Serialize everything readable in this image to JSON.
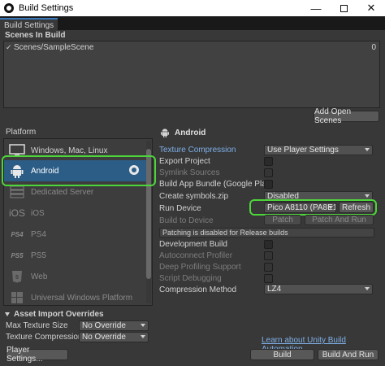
{
  "window": {
    "title": "Build Settings",
    "tab": "Build Settings"
  },
  "scenes": {
    "header": "Scenes In Build",
    "items": [
      {
        "name": "Scenes/SampleScene",
        "index": "0",
        "checked": true
      }
    ],
    "add_open_scenes": "Add Open Scenes"
  },
  "platform": {
    "header": "Platform",
    "items": [
      {
        "label": "Windows, Mac, Linux",
        "icon": "monitor-icon",
        "state": "normal"
      },
      {
        "label": "Android",
        "icon": "android-icon",
        "state": "selected"
      },
      {
        "label": "Dedicated Server",
        "icon": "server-icon",
        "state": "dim"
      },
      {
        "label": "iOS",
        "icon": "ios-icon",
        "state": "dim"
      },
      {
        "label": "PS4",
        "icon": "ps4-icon",
        "state": "dim"
      },
      {
        "label": "PS5",
        "icon": "ps5-icon",
        "state": "dim"
      },
      {
        "label": "Web",
        "icon": "html5-icon",
        "state": "dim"
      },
      {
        "label": "Universal Windows Platform",
        "icon": "windows-icon",
        "state": "dim"
      }
    ]
  },
  "android": {
    "title": "Android",
    "texture_compression": {
      "label": "Texture Compression",
      "value": "Use Player Settings"
    },
    "export_project": {
      "label": "Export Project"
    },
    "symlink_sources": {
      "label": "Symlink Sources"
    },
    "build_app_bundle": {
      "label": "Build App Bundle (Google Play)"
    },
    "create_symbols": {
      "label": "Create symbols.zip",
      "value": "Disabled"
    },
    "run_device": {
      "label": "Run Device",
      "value": "Pico A8110 (PA8E1",
      "refresh": "Refresh"
    },
    "build_to_device": {
      "label": "Build to Device",
      "patch": "Patch",
      "patch_and_run": "Patch And Run"
    },
    "patch_note": "Patching is disabled for Release builds",
    "development_build": {
      "label": "Development Build"
    },
    "autoconnect_profiler": {
      "label": "Autoconnect Profiler"
    },
    "deep_profiling": {
      "label": "Deep Profiling Support"
    },
    "script_debugging": {
      "label": "Script Debugging"
    },
    "compression_method": {
      "label": "Compression Method",
      "value": "LZ4"
    }
  },
  "asset_overrides": {
    "header": "Asset Import Overrides",
    "max_texture_size": {
      "label": "Max Texture Size",
      "value": "No Override"
    },
    "texture_compression": {
      "label": "Texture Compression",
      "value": "No Override"
    }
  },
  "footer": {
    "learn_link": "Learn about Unity Build Automation",
    "player_settings": "Player Settings...",
    "build": "Build",
    "build_and_run": "Build And Run"
  },
  "colors": {
    "accent": "#2c5d87",
    "link": "#7fb0e8",
    "highlight_outline": "#4dd63a"
  }
}
